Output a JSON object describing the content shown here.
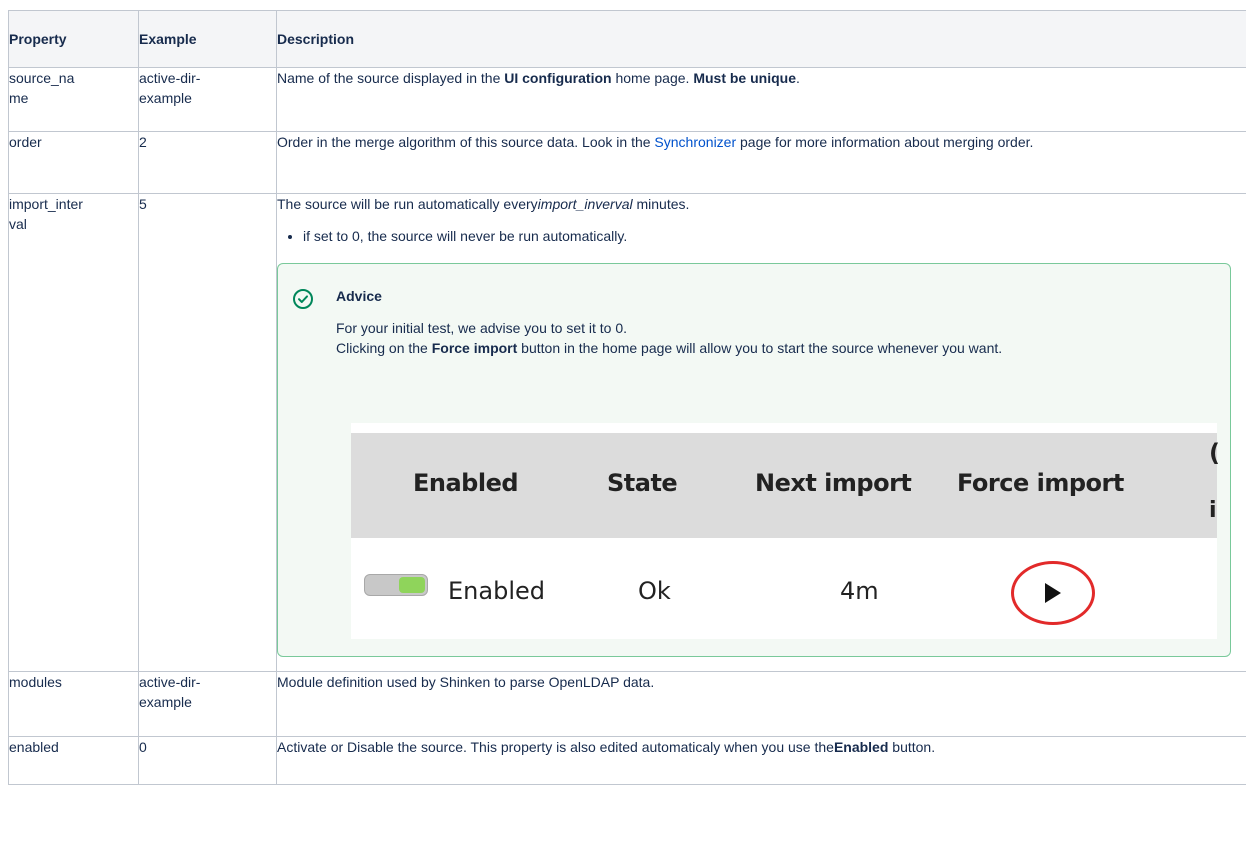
{
  "table": {
    "headers": [
      "Property",
      "Example",
      "Description"
    ],
    "rows": [
      {
        "property": "source_na\nme",
        "property_lines": [
          "source_na",
          "me"
        ],
        "example_lines": [
          "active-dir-",
          "example"
        ],
        "description": {
          "pre": "Name of the source displayed in the ",
          "bold1": "UI configuration",
          "mid": " home page. ",
          "bold2": "Must be unique",
          "post": "."
        }
      },
      {
        "property_lines": [
          "order"
        ],
        "example_lines": [
          "2"
        ],
        "description": {
          "pre": "Order in the merge algorithm of this source data. Look in the ",
          "link": "Synchronizer",
          "post": " page for more information about merging order."
        }
      },
      {
        "property_lines": [
          "import_inter",
          "val"
        ],
        "example_lines": [
          "5"
        ],
        "description": {
          "pre": "The source will be run automatically every",
          "italic": "import_inverval",
          "post": " minutes.",
          "bullet": "if set to 0, the source will never be run automatically."
        },
        "advice": {
          "title": "Advice",
          "line1": "For your initial test, we advise you to set it to 0.",
          "line2_pre": "Clicking on the ",
          "line2_bold": "Force import",
          "line2_post": " button in the home page will allow you to start the source whenever you want.",
          "screenshot": {
            "headers": [
              "Enabled",
              "State",
              "Next import",
              "Force import"
            ],
            "enabled_label": "Enabled",
            "state": "Ok",
            "next_import": "4m",
            "toggle_on": true,
            "accent_green": "#8fd45b",
            "highlight_red": "#e22a2a"
          }
        }
      },
      {
        "property_lines": [
          "modules"
        ],
        "example_lines": [
          "active-dir-",
          "example"
        ],
        "description": {
          "pre": "Module definition used by Shinken to parse OpenLDAP data."
        }
      },
      {
        "property_lines": [
          "enabled"
        ],
        "example_lines": [
          "0"
        ],
        "description": {
          "pre": "Activate or Disable the source. This property is also edited automaticaly when you use the",
          "bold1": "Enabled",
          "post": " button."
        }
      }
    ]
  },
  "colors": {
    "text": "#172b4d",
    "border": "#c1c7d0",
    "header_bg": "#f4f5f7",
    "link": "#0052cc",
    "advice_bg": "#f3f9f4",
    "advice_border": "#79c99a",
    "advice_icon": "#00875a"
  }
}
